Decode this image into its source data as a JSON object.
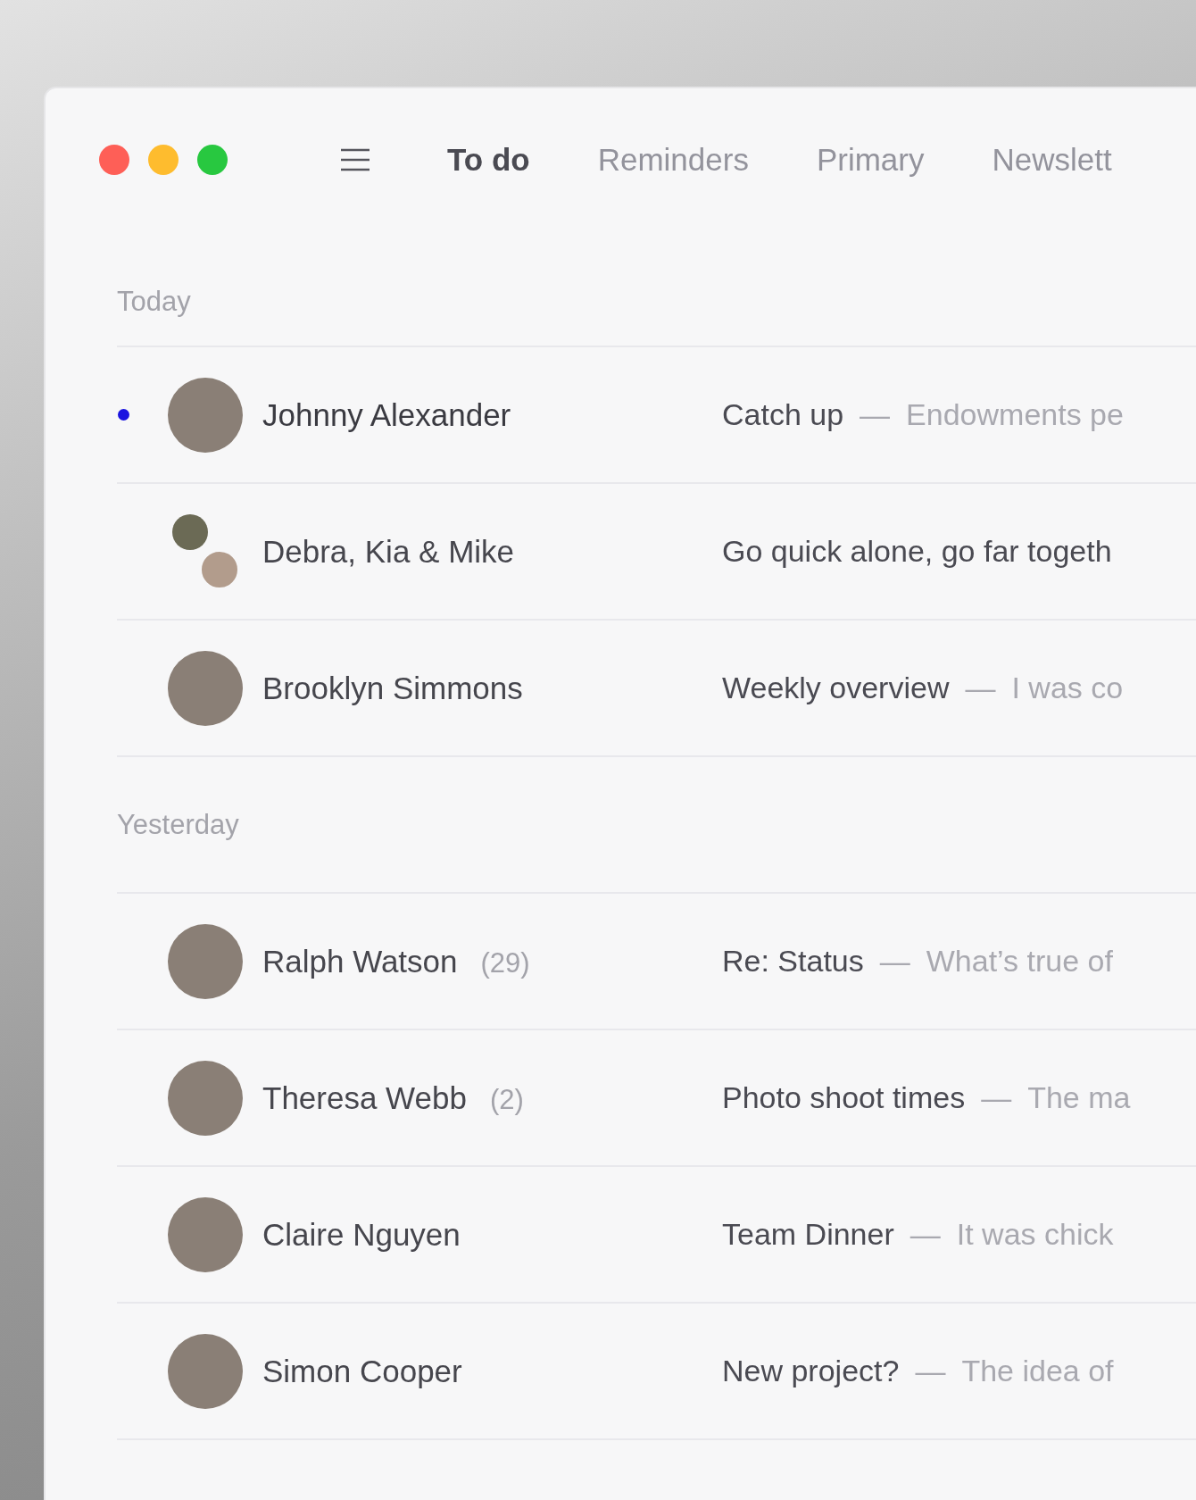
{
  "window": {
    "controls": [
      {
        "color": "#fe5f57"
      },
      {
        "color": "#febc2e"
      },
      {
        "color": "#28c840"
      }
    ]
  },
  "tabs": [
    {
      "label": "To do",
      "selected": true
    },
    {
      "label": "Reminders",
      "selected": false
    },
    {
      "label": "Primary",
      "selected": false
    },
    {
      "label": "Newslett",
      "selected": false
    }
  ],
  "sections": [
    {
      "title": "Today",
      "messages": [
        {
          "sender": "Johnny Alexander",
          "unread": true,
          "kind": "single",
          "subject": "Catch up",
          "dash": "—",
          "preview": "Endowments pe"
        },
        {
          "sender": "Debra, Kia & Mike",
          "unread": false,
          "kind": "group",
          "subject": "Go quick alone, go far togeth"
        },
        {
          "sender": "Brooklyn Simmons",
          "unread": false,
          "kind": "single",
          "subject": "Weekly overview",
          "dash": "—",
          "preview": "I was co"
        }
      ]
    },
    {
      "title": "Yesterday",
      "messages": [
        {
          "sender": "Ralph Watson",
          "count": "(29)",
          "unread": false,
          "kind": "single",
          "subject": "Re: Status",
          "dash": "—",
          "preview": "What’s true of"
        },
        {
          "sender": "Theresa Webb",
          "count": "(2)",
          "unread": false,
          "kind": "single",
          "subject": "Photo shoot times",
          "dash": "—",
          "preview": "The ma"
        },
        {
          "sender": "Claire Nguyen",
          "unread": false,
          "kind": "single",
          "subject": "Team Dinner",
          "dash": "—",
          "preview": "It was chick"
        },
        {
          "sender": "Simon Cooper",
          "unread": false,
          "kind": "single",
          "subject": "New project?",
          "dash": "—",
          "preview": "The idea of"
        }
      ]
    }
  ]
}
